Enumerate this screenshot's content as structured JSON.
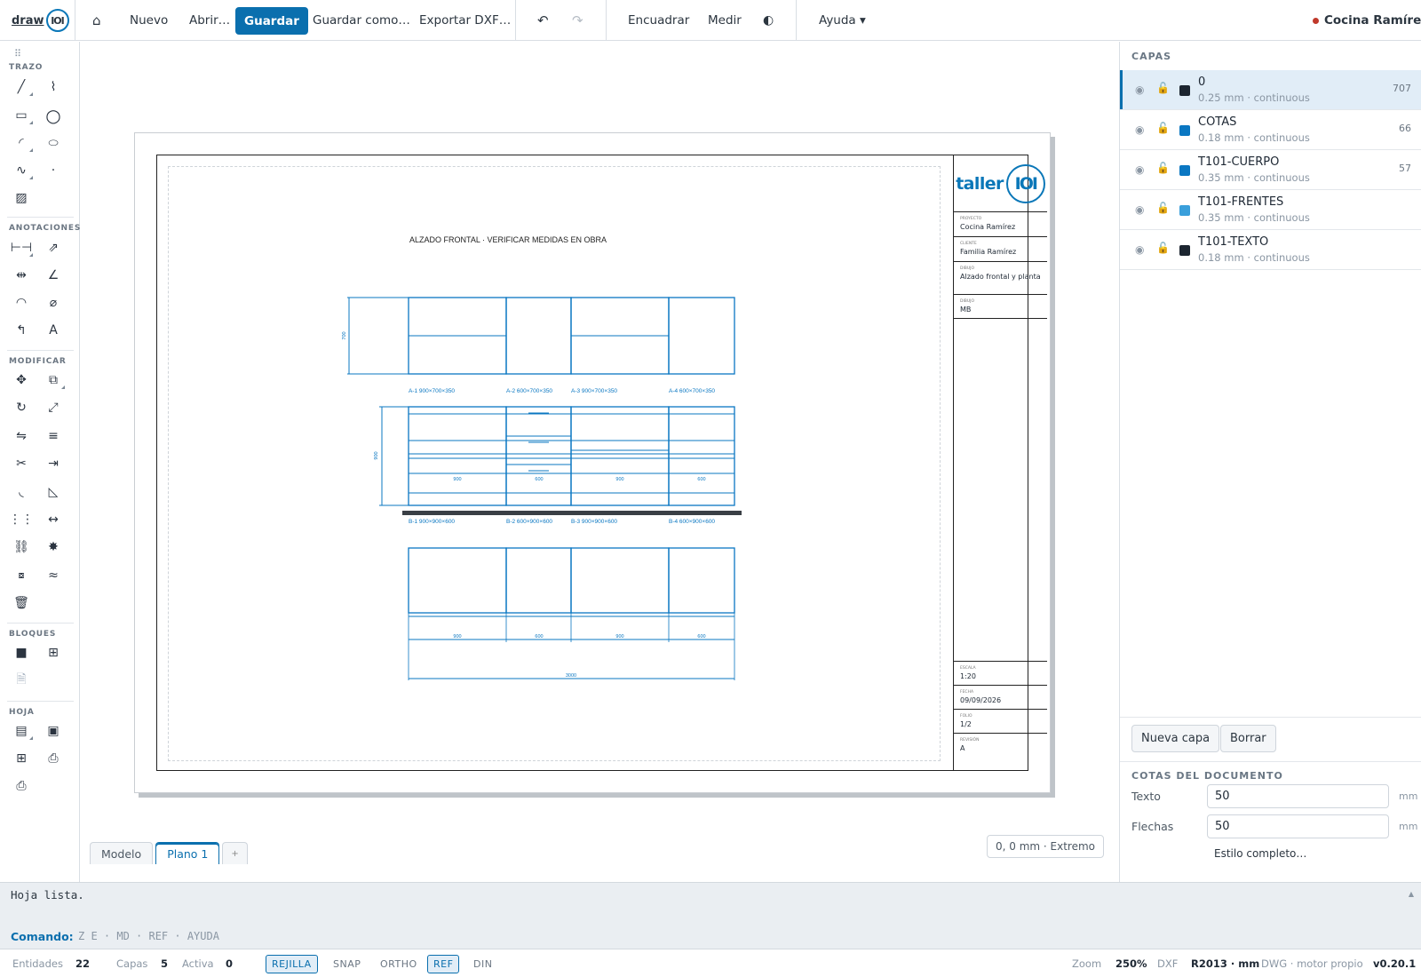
{
  "app": {
    "logo_word": "draw",
    "logo_mark": "IOI"
  },
  "topbar": {
    "home_icon": "home-icon",
    "nuevo": "Nuevo",
    "abrir": "Abrir…",
    "guardar": "Guardar",
    "guardar_como": "Guardar como…",
    "exportar": "Exportar DXF…",
    "undo_icon": "undo-icon",
    "redo_icon": "redo-icon",
    "encuadrar": "Encuadrar",
    "medir": "Medir",
    "contrast_icon": "contrast-icon",
    "ayuda": "Ayuda ▾",
    "document_name": "Cocina Ramírez",
    "document_status_color": "#c0392b"
  },
  "toolbar": {
    "sections": {
      "trazo": "TRAZO",
      "anotaciones": "ANOTACIONES",
      "modificar": "MODIFICAR",
      "bloques": "BLOQUES",
      "hoja": "HOJA"
    }
  },
  "drawing": {
    "heading": "ALZADO FRONTAL · VERIFICAR MEDIDAS EN OBRA",
    "upper_height": "700",
    "base_height": "900",
    "upper_labels": [
      "A-1  900×700×350",
      "A-2  600×700×350",
      "A-3  900×700×350",
      "A-4  600×700×350"
    ],
    "base_labels": [
      "B-1  900×900×600",
      "B-2  600×900×600",
      "B-3  900×900×600",
      "B-4  600×900×600"
    ],
    "base_widths": [
      "900",
      "600",
      "900",
      "600"
    ],
    "plan_widths": [
      "900",
      "600",
      "900",
      "600"
    ],
    "total_width": "3000"
  },
  "title_block": {
    "logo_word": "taller",
    "logo_mark": "IOI",
    "proyecto_label": "PROYECTO",
    "proyecto": "Cocina Ramírez",
    "cliente_label": "CLIENTE",
    "cliente": "Familia Ramírez",
    "dibujo_label": "DIBUJO",
    "dibujo": "Alzado frontal y planta",
    "dibujo2_label": "DIBUJO",
    "dibujo2": "MB",
    "escala_label": "ESCALA",
    "escala": "1:20",
    "fecha_label": "FECHA",
    "fecha": "09/09/2026",
    "folio_label": "FOLIO",
    "folio": "1/2",
    "revision_label": "REVISIÓN",
    "revision": "A"
  },
  "tabs": {
    "modelo": "Modelo",
    "plano": "Plano 1",
    "add": "+"
  },
  "coords": "0, 0 mm · Extremo",
  "layers_panel": {
    "title": "CAPAS",
    "layers": [
      {
        "name": "0",
        "meta": "0.25 mm · continuous",
        "count": "707",
        "color": "#1c2530"
      },
      {
        "name": "COTAS",
        "meta": "0.18 mm · continuous",
        "count": "66",
        "color": "#0a77c2"
      },
      {
        "name": "T101-CUERPO",
        "meta": "0.35 mm · continuous",
        "count": "57",
        "color": "#0a77c2"
      },
      {
        "name": "T101-FRENTES",
        "meta": "0.35 mm · continuous",
        "count": "",
        "color": "#3a9fdb"
      },
      {
        "name": "T101-TEXTO",
        "meta": "0.18 mm · continuous",
        "count": "",
        "color": "#1c2530"
      }
    ],
    "new_layer": "Nueva capa",
    "delete": "Borrar"
  },
  "dims_panel": {
    "title": "COTAS DEL DOCUMENTO",
    "texto_label": "Texto",
    "texto_value": "50",
    "flechas_label": "Flechas",
    "flechas_value": "50",
    "unit": "mm",
    "full_style": "Estilo completo…"
  },
  "console": {
    "log": "Hoja lista.",
    "label": "Comando:",
    "hint": "Z E · MD · REF · AYUDA"
  },
  "status": {
    "entidades_label": "Entidades",
    "entidades": "22",
    "capas_label": "Capas",
    "capas": "5",
    "activa_label": "Activa",
    "activa": "0",
    "rejilla": "REJILLA",
    "snap": "SNAP",
    "ortho": "ORTHO",
    "ref": "REF",
    "din": "DIN",
    "zoom_label": "Zoom",
    "zoom": "250%",
    "dxf_label": "DXF",
    "dxf": "R2013 · mm",
    "engine": "DWG · motor propio",
    "version": "v0.20.1"
  }
}
